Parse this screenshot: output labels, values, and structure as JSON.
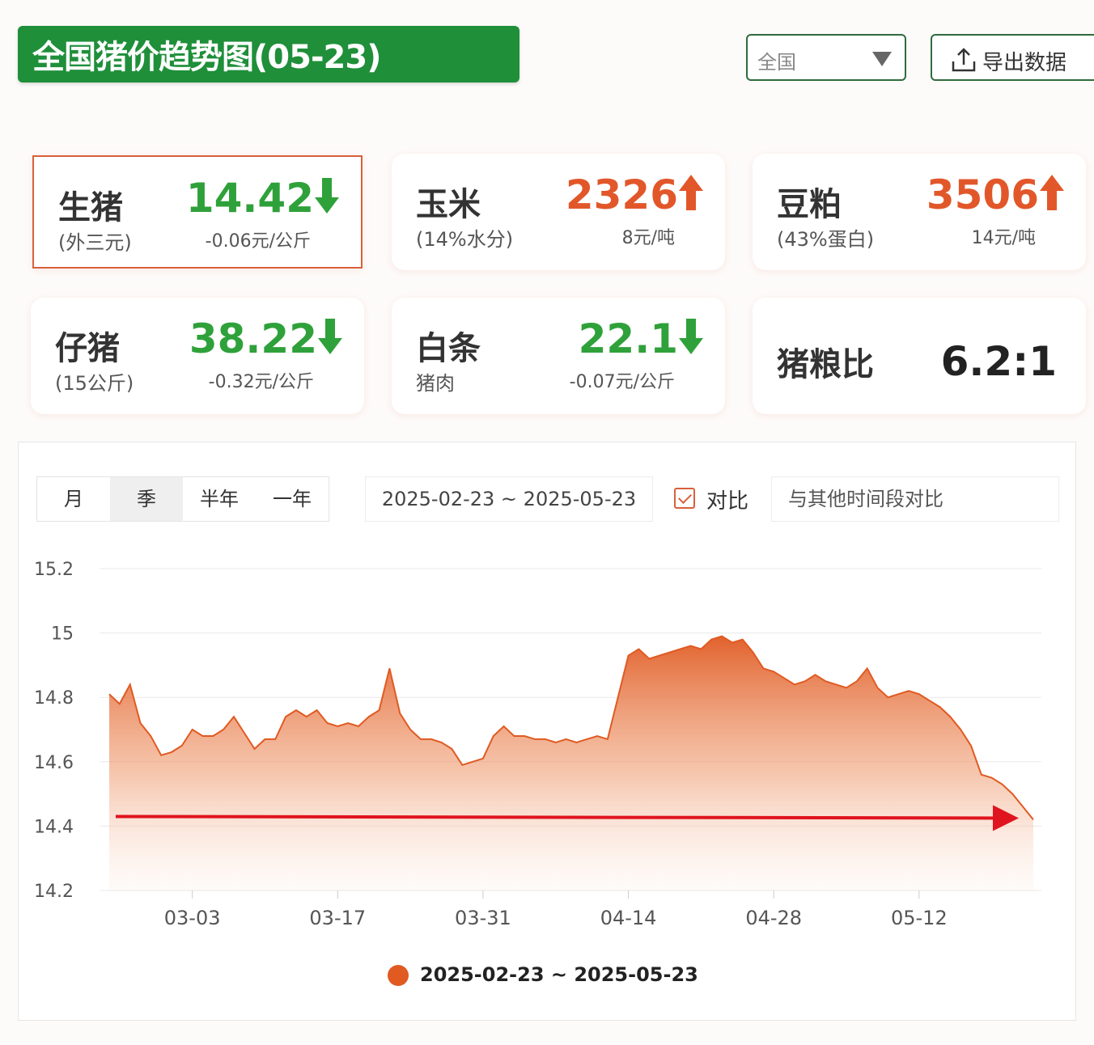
{
  "header": {
    "title": "全国猪价趋势图(05-23)",
    "region_select": "全国",
    "export_label": "导出数据"
  },
  "cards": [
    {
      "name": "生猪",
      "sub": "(外三元)",
      "price": "14.42",
      "direction": "down",
      "change": "-0.06元/公斤"
    },
    {
      "name": "玉米",
      "sub": "(14%水分)",
      "price": "2326",
      "direction": "up",
      "change": "8元/吨"
    },
    {
      "name": "豆粕",
      "sub": "(43%蛋白)",
      "price": "3506",
      "direction": "up",
      "change": "14元/吨"
    },
    {
      "name": "仔猪",
      "sub": "(15公斤)",
      "price": "38.22",
      "direction": "down",
      "change": "-0.32元/公斤"
    },
    {
      "name": "白条",
      "sub": "猪肉",
      "price": "22.1",
      "direction": "down",
      "change": "-0.07元/公斤"
    },
    {
      "name": "猪粮比",
      "ratio": "6.2:1"
    }
  ],
  "controls": {
    "range_tabs": [
      "月",
      "季",
      "半年",
      "一年"
    ],
    "selected_tab": "季",
    "date_range": "2025-02-23 ~ 2025-05-23",
    "compare_checked": true,
    "compare_label": "对比",
    "compare_placeholder": "与其他时间段对比"
  },
  "colors": {
    "brand_green": "#1f8f3a",
    "up": "#e2572a",
    "down": "#2fa13a",
    "series": "#e05a22",
    "arrow_annotation": "#e0141e"
  },
  "chart_data": {
    "type": "area",
    "ylim": [
      14.2,
      15.2
    ],
    "yticks": [
      "15.2",
      "15",
      "14.8",
      "14.6",
      "14.4",
      "14.2"
    ],
    "xticks": [
      "03-03",
      "03-17",
      "03-31",
      "04-14",
      "04-28",
      "05-12"
    ],
    "grid": true,
    "legend": "bottom-center",
    "series": [
      {
        "name": "2025-02-23 ~ 2025-05-23",
        "x": [
          "02-23",
          "02-24",
          "02-25",
          "02-26",
          "02-27",
          "02-28",
          "03-01",
          "03-02",
          "03-03",
          "03-04",
          "03-05",
          "03-06",
          "03-07",
          "03-08",
          "03-09",
          "03-10",
          "03-11",
          "03-12",
          "03-13",
          "03-14",
          "03-15",
          "03-16",
          "03-17",
          "03-18",
          "03-19",
          "03-20",
          "03-21",
          "03-22",
          "03-23",
          "03-24",
          "03-25",
          "03-26",
          "03-27",
          "03-28",
          "03-29",
          "03-30",
          "03-31",
          "04-01",
          "04-02",
          "04-03",
          "04-04",
          "04-05",
          "04-06",
          "04-07",
          "04-08",
          "04-09",
          "04-10",
          "04-11",
          "04-12",
          "04-13",
          "04-14",
          "04-15",
          "04-16",
          "04-17",
          "04-18",
          "04-19",
          "04-20",
          "04-21",
          "04-22",
          "04-23",
          "04-24",
          "04-25",
          "04-26",
          "04-27",
          "04-28",
          "04-29",
          "04-30",
          "05-01",
          "05-02",
          "05-03",
          "05-04",
          "05-05",
          "05-06",
          "05-07",
          "05-08",
          "05-09",
          "05-10",
          "05-11",
          "05-12",
          "05-13",
          "05-14",
          "05-15",
          "05-16",
          "05-17",
          "05-18",
          "05-19",
          "05-20",
          "05-21",
          "05-22",
          "05-23"
        ],
        "values": [
          14.81,
          14.78,
          14.84,
          14.72,
          14.68,
          14.62,
          14.63,
          14.65,
          14.7,
          14.68,
          14.68,
          14.7,
          14.74,
          14.69,
          14.64,
          14.67,
          14.67,
          14.74,
          14.76,
          14.74,
          14.76,
          14.72,
          14.71,
          14.72,
          14.71,
          14.74,
          14.76,
          14.89,
          14.75,
          14.7,
          14.67,
          14.67,
          14.66,
          14.64,
          14.59,
          14.6,
          14.61,
          14.68,
          14.71,
          14.68,
          14.68,
          14.67,
          14.67,
          14.66,
          14.67,
          14.66,
          14.67,
          14.68,
          14.67,
          14.8,
          14.93,
          14.95,
          14.92,
          14.93,
          14.94,
          14.95,
          14.96,
          14.95,
          14.98,
          14.99,
          14.97,
          14.98,
          14.94,
          14.89,
          14.88,
          14.86,
          14.84,
          14.85,
          14.87,
          14.85,
          14.84,
          14.83,
          14.85,
          14.89,
          14.83,
          14.8,
          14.81,
          14.82,
          14.81,
          14.79,
          14.77,
          14.74,
          14.7,
          14.65,
          14.56,
          14.55,
          14.53,
          14.5,
          14.46,
          14.42
        ]
      }
    ],
    "annotation": {
      "type": "arrow",
      "y": 14.43,
      "color": "#e0141e"
    }
  }
}
